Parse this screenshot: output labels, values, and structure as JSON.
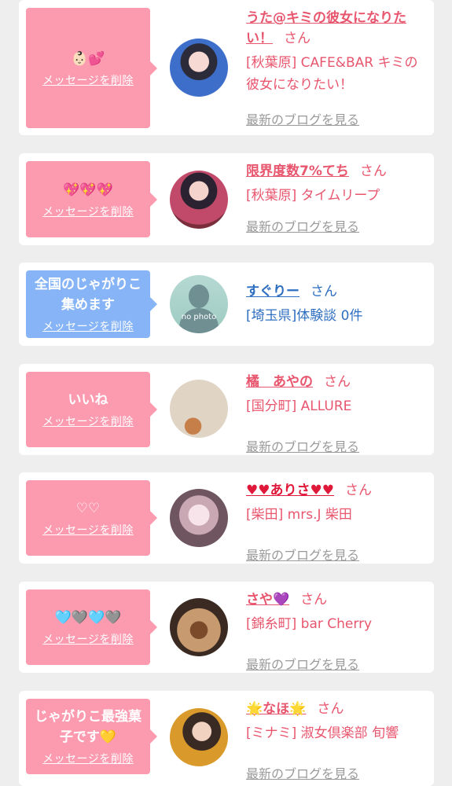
{
  "common": {
    "delete_label": "メッセージを削除",
    "blog_label": "最新のブログを見る",
    "san_label": "さん"
  },
  "colors": {
    "pink_bubble": "#fc9bb0",
    "blue_bubble": "#86b4f6",
    "name_pink": "#e8566e",
    "name_blue": "#2f6fc1",
    "link_gray": "#9a9a9a"
  },
  "items": [
    {
      "message": "👶🏻💕",
      "name": "うた@キミの彼女になりたい！",
      "shop": "[秋葉原] CAFE&BAR キミの彼女になりたい！"
    },
    {
      "message": "💖💖💖",
      "name": "限界度数7%てち",
      "shop": "[秋葉原] タイムリープ"
    },
    {
      "message": "全国のじゃがりこ集めます",
      "name": "すぐりー",
      "shop": "[埼玉県]体験談 0件",
      "avatar_text": "no photo"
    },
    {
      "message": "いいね",
      "name": "橘　あやの",
      "shop": "[国分町] ALLURE"
    },
    {
      "message": "♡♡",
      "name": "♥♥ありさ♥♥",
      "shop": "[柴田] mrs.J 柴田"
    },
    {
      "message": "🩵🩶🩵🩶",
      "name": "さや💜",
      "shop": "[錦糸町] bar Cherry"
    },
    {
      "message": "じゃがりこ最強菓子です💛",
      "name": "🌟なほ🌟",
      "shop": "[ミナミ] 淑女倶楽部 旬響"
    }
  ]
}
